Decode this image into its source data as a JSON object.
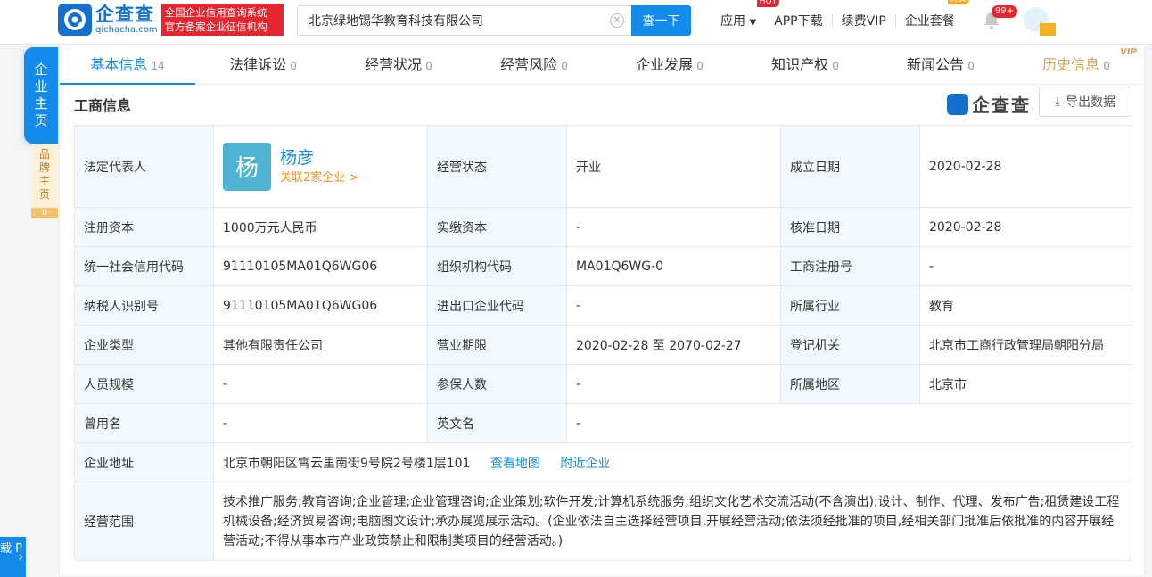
{
  "header": {
    "logo_cn": "企查查",
    "logo_en": "qichacha.com",
    "logo_badge_line1": "全国企业信用查询系统",
    "logo_badge_line2": "官方备案企业征信机构",
    "search_value": "北京绿地锡华教育科技有限公司",
    "search_button": "查一下",
    "nav": {
      "app": "应用",
      "app_badge": "HOT",
      "app_download": "APP下载",
      "renew_vip": "续费VIP",
      "package": "企业套餐",
      "package_badge": "免费",
      "notify_count": "99+"
    }
  },
  "side": {
    "main_tab": [
      "企",
      "业",
      "主",
      "页"
    ],
    "brand_tab": [
      "品",
      "牌",
      "主",
      "页"
    ],
    "brand_count": "0",
    "app_float": "载 P"
  },
  "tabs": [
    {
      "label": "基本信息",
      "count": "14"
    },
    {
      "label": "法律诉讼",
      "count": "0"
    },
    {
      "label": "经营状况",
      "count": "0"
    },
    {
      "label": "经营风险",
      "count": "0"
    },
    {
      "label": "企业发展",
      "count": "0"
    },
    {
      "label": "知识产权",
      "count": "0"
    },
    {
      "label": "新闻公告",
      "count": "0"
    },
    {
      "label": "历史信息",
      "count": "0",
      "tag": "VIP"
    }
  ],
  "section": {
    "title": "工商信息",
    "watermark": "企查查",
    "export_button": "导出数据"
  },
  "info": {
    "legal_rep_label": "法定代表人",
    "legal_rep_avatar": "杨",
    "legal_rep_name": "杨彦",
    "legal_rep_link": "关联2家企业 >",
    "status_label": "经营状态",
    "status_value": "开业",
    "found_label": "成立日期",
    "found_value": "2020-02-28",
    "reg_capital_label": "注册资本",
    "reg_capital_value": "1000万元人民币",
    "paid_capital_label": "实缴资本",
    "paid_capital_value": "-",
    "approve_label": "核准日期",
    "approve_value": "2020-02-28",
    "credit_code_label": "统一社会信用代码",
    "credit_code_value": "91110105MA01Q6WG06",
    "org_code_label": "组织机构代码",
    "org_code_value": "MA01Q6WG-0",
    "reg_no_label": "工商注册号",
    "reg_no_value": "-",
    "taxpayer_label": "纳税人识别号",
    "taxpayer_value": "91110105MA01Q6WG06",
    "import_export_label": "进出口企业代码",
    "import_export_value": "-",
    "industry_label": "所属行业",
    "industry_value": "教育",
    "type_label": "企业类型",
    "type_value": "其他有限责任公司",
    "term_label": "营业期限",
    "term_value": "2020-02-28 至 2070-02-27",
    "authority_label": "登记机关",
    "authority_value": "北京市工商行政管理局朝阳分局",
    "staff_label": "人员规模",
    "staff_value": "-",
    "insured_label": "参保人数",
    "insured_value": "-",
    "region_label": "所属地区",
    "region_value": "北京市",
    "former_name_label": "曾用名",
    "former_name_value": "-",
    "english_name_label": "英文名",
    "english_name_value": "-",
    "address_label": "企业地址",
    "address_value": "北京市朝阳区霄云里南街9号院2号楼1层101",
    "map_link": "查看地图",
    "nearby_link": "附近企业",
    "scope_label": "经营范围",
    "scope_value": "技术推广服务;教育咨询;企业管理;企业管理咨询;企业策划;软件开发;计算机系统服务;组织文化艺术交流活动(不含演出);设计、制作、代理、发布广告;租赁建设工程机械设备;经济贸易咨询;电脑图文设计;承办展览展示活动。(企业依法自主选择经营项目,开展经营活动;依法须经批准的项目,经相关部门批准后依批准的内容开展经营活动;不得从事本市产业政策禁止和限制类项目的经营活动。)"
  }
}
